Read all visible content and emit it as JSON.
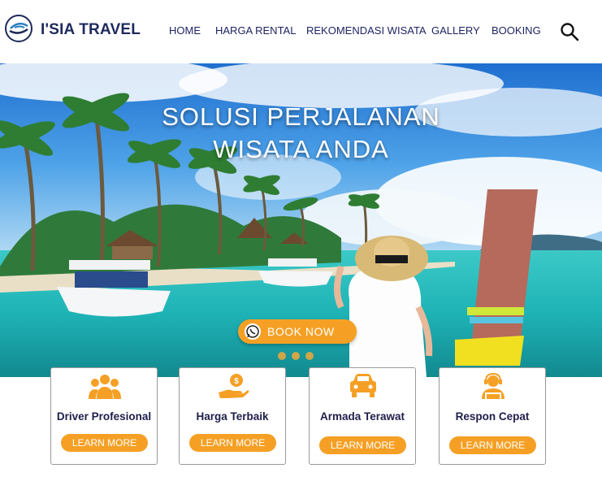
{
  "brand": {
    "name": "I'SIA TRAVEL"
  },
  "nav": {
    "items": [
      "HOME",
      "HARGA RENTAL",
      "REKOMENDASI WISATA",
      "GALLERY",
      "BOOKING"
    ]
  },
  "hero": {
    "headline_line1": "SOLUSI PERJALANAN",
    "headline_line2": "WISATA ANDA",
    "book_now_label": "BOOK NOW",
    "slides": 3
  },
  "features": [
    {
      "title": "Driver Profesional",
      "cta": "LEARN MORE",
      "icon": "users-group-icon"
    },
    {
      "title": "Harga Terbaik",
      "cta": "LEARN MORE",
      "icon": "hand-coin-icon"
    },
    {
      "title": "Armada Terawat",
      "cta": "LEARN MORE",
      "icon": "car-icon"
    },
    {
      "title": "Respon Cepat",
      "cta": "LEARN MORE",
      "icon": "support-agent-icon"
    }
  ],
  "colors": {
    "accent": "#f5a025",
    "brand_text": "#1e2a5c",
    "nav_text": "#1e2463"
  }
}
